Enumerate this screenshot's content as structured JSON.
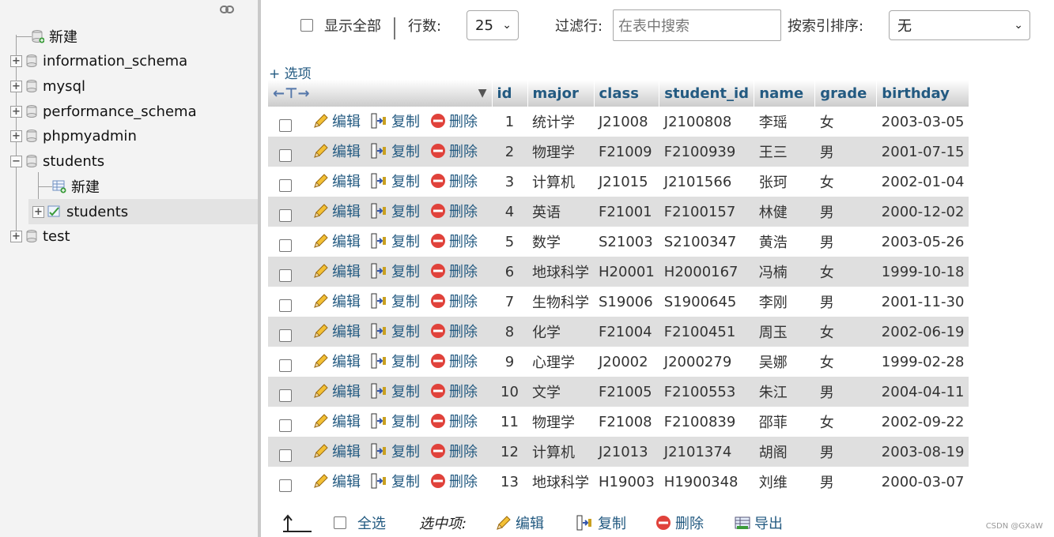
{
  "nav": {
    "items": [
      {
        "label": "新建",
        "type": "new"
      },
      {
        "label": "information_schema",
        "type": "db"
      },
      {
        "label": "mysql",
        "type": "db"
      },
      {
        "label": "performance_schema",
        "type": "db"
      },
      {
        "label": "phpmyadmin",
        "type": "db"
      },
      {
        "label": "students",
        "type": "db-open"
      },
      {
        "label": "新建",
        "type": "table-new"
      },
      {
        "label": "students",
        "type": "table"
      },
      {
        "label": "test",
        "type": "db"
      }
    ]
  },
  "toolbar": {
    "show_all": "显示全部",
    "rows_label": "行数:",
    "rows_value": "25",
    "filter_label": "过滤行:",
    "filter_placeholder": "在表中搜索",
    "sort_label": "按索引排序:",
    "sort_value": "无"
  },
  "options_link": "+ 选项",
  "table": {
    "columns": [
      "id",
      "major",
      "class",
      "student_id",
      "name",
      "grade",
      "birthday"
    ],
    "actions": {
      "edit": "编辑",
      "copy": "复制",
      "delete": "删除"
    },
    "rows": [
      [
        "1",
        "统计学",
        "J21008",
        "J2100808",
        "李瑶",
        "女",
        "2003-03-05"
      ],
      [
        "2",
        "物理学",
        "F21009",
        "F2100939",
        "王三",
        "男",
        "2001-07-15"
      ],
      [
        "3",
        "计算机",
        "J21015",
        "J2101566",
        "张珂",
        "女",
        "2002-01-04"
      ],
      [
        "4",
        "英语",
        "F21001",
        "F2100157",
        "林健",
        "男",
        "2000-12-02"
      ],
      [
        "5",
        "数学",
        "S21003",
        "S2100347",
        "黄浩",
        "男",
        "2003-05-26"
      ],
      [
        "6",
        "地球科学",
        "H20001",
        "H2000167",
        "冯楠",
        "女",
        "1999-10-18"
      ],
      [
        "7",
        "生物科学",
        "S19006",
        "S1900645",
        "李刚",
        "男",
        "2001-11-30"
      ],
      [
        "8",
        "化学",
        "F21004",
        "F2100451",
        "周玉",
        "女",
        "2002-06-19"
      ],
      [
        "9",
        "心理学",
        "J20002",
        "J2000279",
        "吴娜",
        "女",
        "1999-02-28"
      ],
      [
        "10",
        "文学",
        "F21005",
        "F2100553",
        "朱江",
        "男",
        "2004-04-11"
      ],
      [
        "11",
        "物理学",
        "F21008",
        "F2100839",
        "邵菲",
        "女",
        "2002-09-22"
      ],
      [
        "12",
        "计算机",
        "J21013",
        "J2101374",
        "胡阁",
        "男",
        "2003-08-19"
      ],
      [
        "13",
        "地球科学",
        "H19003",
        "H1900348",
        "刘维",
        "男",
        "2000-03-07"
      ]
    ]
  },
  "footer": {
    "select_all": "全选",
    "with_selected": "选中项:",
    "edit": "编辑",
    "copy": "复制",
    "delete": "删除",
    "export": "导出"
  },
  "watermark": "CSDN @GXaW",
  "colors": {
    "link": "#235a81",
    "row_even": "#dfdfdf",
    "nav_bg": "#f3f3f3"
  }
}
